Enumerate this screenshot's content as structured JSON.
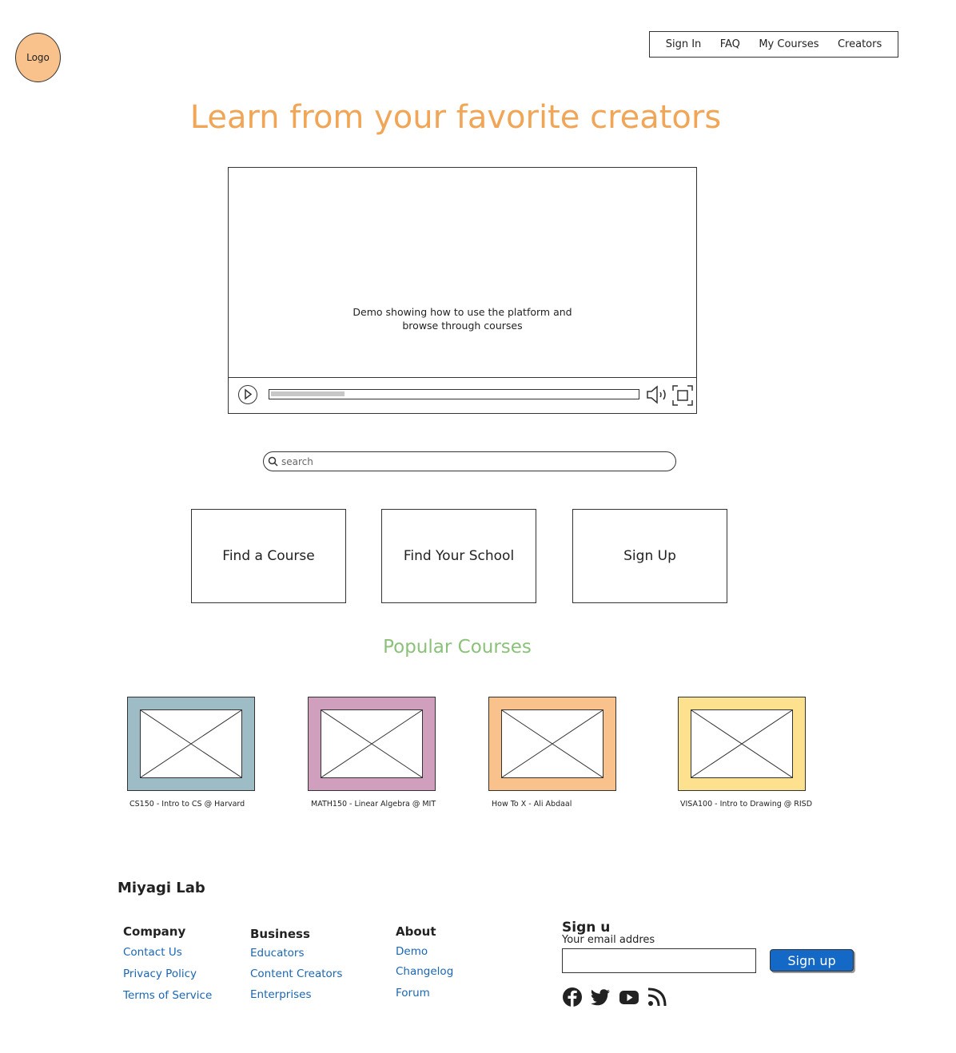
{
  "logo": {
    "label": "Logo"
  },
  "nav": {
    "items": [
      "Sign In",
      "FAQ",
      "My Courses",
      "Creators"
    ]
  },
  "hero": {
    "title": "Learn from your favorite creators"
  },
  "video": {
    "caption_line1": "Demo showing how to use the platform and",
    "caption_line2": "browse through courses",
    "progress": 0.2
  },
  "search": {
    "placeholder": "search"
  },
  "actions": [
    "Find a Course",
    "Find Your School",
    "Sign Up"
  ],
  "popular": {
    "title": "Popular Courses",
    "courses": [
      {
        "label": "CS150 - Intro to CS @ Harvard",
        "color": "#9dbcc6"
      },
      {
        "label": "MATH150 - Linear Algebra @ MIT",
        "color": "#cf9fbd"
      },
      {
        "label": "How To X - Ali Abdaal",
        "color": "#f9c28d"
      },
      {
        "label": "VISA100 - Intro to Drawing @ RISD",
        "color": "#fde18f"
      }
    ]
  },
  "footer": {
    "brand": "Miyagi Lab",
    "columns": [
      {
        "heading": "Company",
        "links": [
          "Contact Us",
          "Privacy Policy",
          "Terms of Service"
        ]
      },
      {
        "heading": "Business",
        "links": [
          "Educators",
          "Content Creators",
          "Enterprises"
        ]
      },
      {
        "heading": "About",
        "links": [
          "Demo",
          "Changelog",
          "Forum"
        ]
      }
    ],
    "signup": {
      "heading": "Sign u",
      "email_label": "Your email addres",
      "email_value": "",
      "button": "Sign up"
    },
    "social": [
      "facebook-icon",
      "twitter-icon",
      "youtube-icon",
      "rss-icon"
    ]
  },
  "colors": {
    "accent": "#f1a657",
    "section": "#8bc17a",
    "link": "#1a66b3",
    "button": "#1469c7"
  }
}
